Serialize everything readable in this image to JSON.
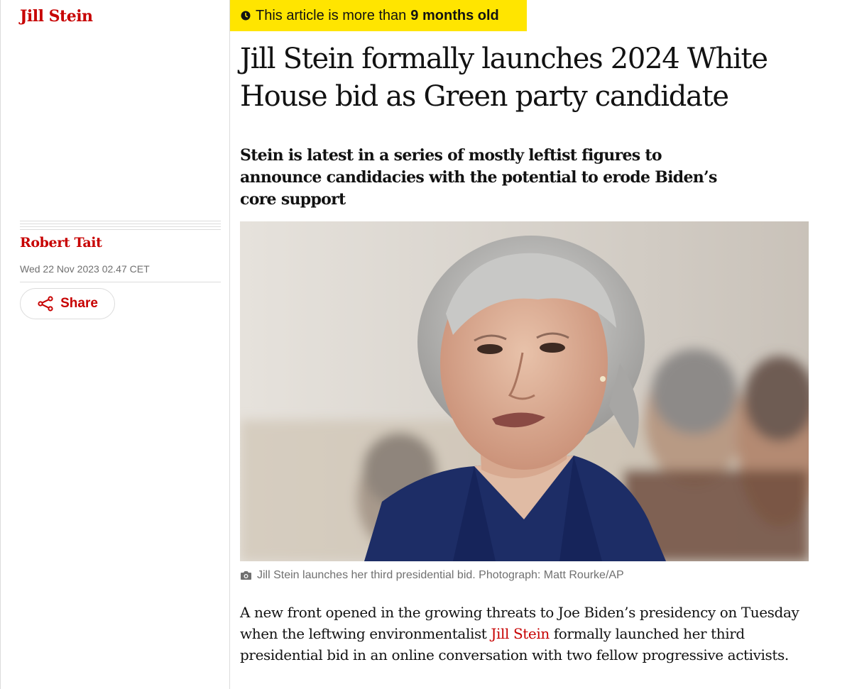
{
  "section": {
    "tag": "Jill Stein"
  },
  "meta": {
    "byline": "Robert Tait",
    "date": "Wed 22 Nov 2023 02.47 CET",
    "share_label": "Share"
  },
  "age_notice": {
    "prefix": "This article is more than",
    "age": "9 months old"
  },
  "article": {
    "headline": "Jill Stein formally launches 2024 White House bid as Green party candidate",
    "standfirst": "Stein is latest in a series of mostly leftist figures to announce candidacies with the potential to erode Biden’s core support",
    "caption": "Jill Stein launches her third presidential bid. Photograph: Matt Rourke/AP",
    "body": {
      "before_link": "A new front opened in the growing threats to Joe Biden’s presidency on Tuesday when the leftwing environmentalist ",
      "link_text": "Jill Stein",
      "after_link": " formally launched her third presidential bid in an online conversation with two fellow progressive activists."
    }
  },
  "colors": {
    "brand_red": "#c70000",
    "badge_yellow": "#ffe500",
    "muted_gray": "#707070"
  },
  "icons": [
    "clock-icon",
    "share-icon",
    "camera-icon"
  ]
}
